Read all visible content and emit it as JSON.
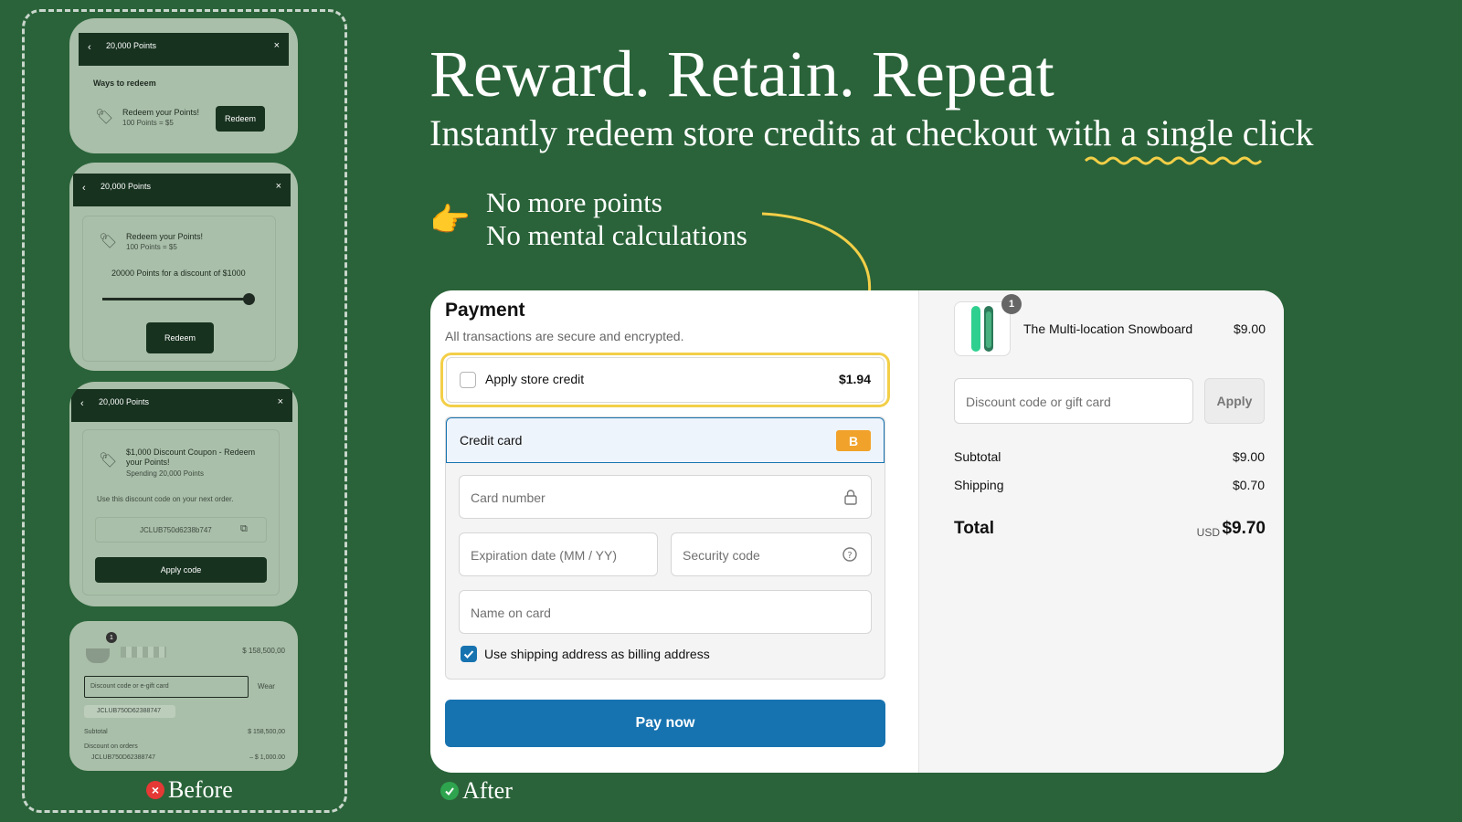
{
  "colors": {
    "background": "#2a6339",
    "accent_yellow": "#f3cf48",
    "pay_blue": "#1773b0",
    "badge_orange": "#f1a22a"
  },
  "before": {
    "label": "Before",
    "screen1": {
      "points": "20,000 Points",
      "heading": "Ways to redeem",
      "item_title": "Redeem your Points!",
      "item_rate": "100 Points = $5",
      "button": "Redeem"
    },
    "screen2": {
      "points": "20,000 Points",
      "item_title": "Redeem your Points!",
      "item_rate": "100 Points = $5",
      "discount_text": "20000 Points for a discount of $1000",
      "button": "Redeem",
      "slider_fraction": 1.0
    },
    "screen3": {
      "points": "20,000 Points",
      "coupon_title": "$1,000 Discount Coupon - Redeem your Points!",
      "coupon_sub": "Spending 20,000 Points",
      "hint": "Use this discount code on your next order.",
      "code": "JCLUB750d6238b747",
      "button": "Apply code"
    },
    "screen4": {
      "badge": "1",
      "price": "$ 158,500,00",
      "discount_placeholder": "Discount code or e-gift card",
      "apply": "Wear",
      "applied_code": "JCLUB750D62388747",
      "subtotal_label": "Subtotal",
      "subtotal_value": "$ 158,500,00",
      "discount_label": "Discount on orders",
      "discount_code": "JCLUB750D62388747",
      "discount_value": "– $ 1,000.00"
    }
  },
  "hero": {
    "headline": "Reward.  Retain. Repeat",
    "subline": "Instantly redeem store credits at checkout with a single click",
    "bullet1": "No more points",
    "bullet2": "No mental calculations",
    "pointer_icon": "pointing-hand-emoji"
  },
  "payment": {
    "title": "Payment",
    "subtitle": "All transactions are secure and encrypted.",
    "store_credit_label": "Apply store credit",
    "store_credit_amount": "$1.94",
    "store_credit_checked": false,
    "credit_card_label": "Credit card",
    "card_brand_badge": "B",
    "card_number_placeholder": "Card number",
    "expiry_placeholder": "Expiration date (MM / YY)",
    "security_placeholder": "Security code",
    "name_placeholder": "Name on card",
    "billing_label": "Use shipping address as billing address",
    "billing_checked": true,
    "pay_button": "Pay now"
  },
  "summary": {
    "product_qty": "1",
    "product_name": "The Multi-location Snowboard",
    "product_price": "$9.00",
    "discount_placeholder": "Discount code or gift card",
    "apply_label": "Apply",
    "subtotal_label": "Subtotal",
    "subtotal_value": "$9.00",
    "shipping_label": "Shipping",
    "shipping_value": "$0.70",
    "total_label": "Total",
    "currency": "USD",
    "total_value": "$9.70"
  },
  "after": {
    "label": "After"
  }
}
